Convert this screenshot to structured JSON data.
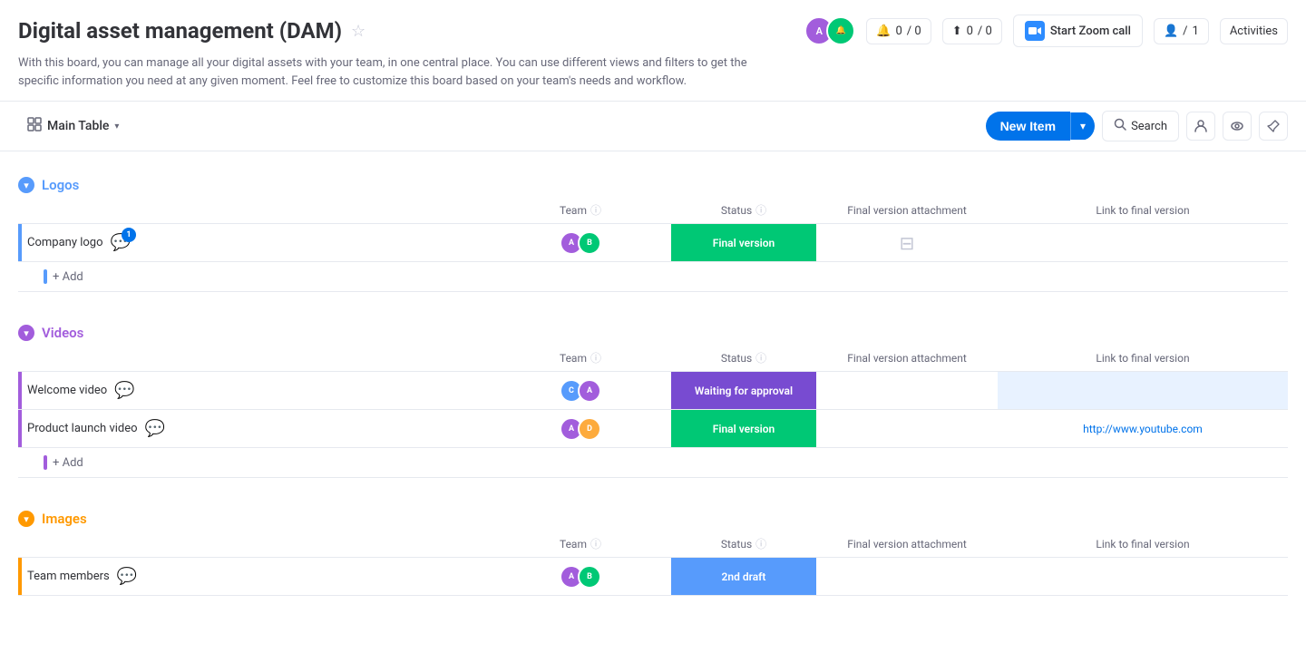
{
  "header": {
    "title": "Digital asset management (DAM)",
    "star_icon": "★",
    "description": "With this board, you can manage all your digital assets with your team, in one central place. You can use different views and filters to get the specific information you need at any given moment. Feel free to customize this board based on your team's needs and workflow.",
    "notifications_count": "0",
    "updates_count": "0",
    "zoom_label": "Start Zoom call",
    "people_count": "1",
    "activity_label": "Activities"
  },
  "toolbar": {
    "main_table_label": "Main Table",
    "new_item_label": "New Item",
    "search_label": "Search"
  },
  "groups": [
    {
      "id": "logos",
      "title": "Logos",
      "color": "#579bfc",
      "columns": {
        "team": "Team",
        "status": "Status",
        "attachment": "Final version attachment",
        "link": "Link to final version"
      },
      "rows": [
        {
          "name": "Company logo",
          "has_notification": true,
          "notification_count": "1",
          "team_avatars": [
            "ra1",
            "ra2"
          ],
          "status": "Final version",
          "status_class": "status-final",
          "has_attachment": true,
          "link": ""
        }
      ],
      "add_label": "+ Add"
    },
    {
      "id": "videos",
      "title": "Videos",
      "color": "#a25ddc",
      "columns": {
        "team": "Team",
        "status": "Status",
        "attachment": "Final version attachment",
        "link": "Link to final version"
      },
      "rows": [
        {
          "name": "Welcome video",
          "has_notification": false,
          "notification_count": "",
          "team_avatars": [
            "ra3",
            "ra1"
          ],
          "status": "Waiting for approval",
          "status_class": "status-waiting",
          "has_attachment": false,
          "link": "",
          "link_highlight": true
        },
        {
          "name": "Product launch video",
          "has_notification": false,
          "notification_count": "",
          "team_avatars": [
            "ra1",
            "ra5"
          ],
          "status": "Final version",
          "status_class": "status-final",
          "has_attachment": false,
          "link": "http://www.youtube.com",
          "link_highlight": false
        }
      ],
      "add_label": "+ Add"
    },
    {
      "id": "images",
      "title": "Images",
      "color": "#ff9900",
      "columns": {
        "team": "Team",
        "status": "Status",
        "attachment": "Final version attachment",
        "link": "Link to final version"
      },
      "rows": [
        {
          "name": "Team members",
          "has_notification": false,
          "notification_count": "",
          "team_avatars": [
            "ra1",
            "ra2"
          ],
          "status": "2nd draft",
          "status_class": "status-draft",
          "has_attachment": false,
          "link": ""
        }
      ],
      "add_label": "+ Add"
    }
  ]
}
